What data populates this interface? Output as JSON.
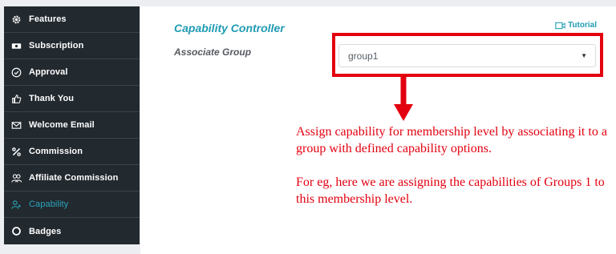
{
  "sidebar": {
    "items": [
      {
        "label": "Features",
        "icon": "gear-icon"
      },
      {
        "label": "Subscription",
        "icon": "money-icon"
      },
      {
        "label": "Approval",
        "icon": "check-circle-icon"
      },
      {
        "label": "Thank You",
        "icon": "thumbs-up-icon"
      },
      {
        "label": "Welcome Email",
        "icon": "mail-icon"
      },
      {
        "label": "Commission",
        "icon": "percent-icon"
      },
      {
        "label": "Affiliate Commission",
        "icon": "users-icon"
      },
      {
        "label": "Capability",
        "icon": "user-plus-icon",
        "active": true
      },
      {
        "label": "Badges",
        "icon": "circle-icon"
      }
    ]
  },
  "main": {
    "title": "Capability Controller",
    "tutorial_label": "Tutorial",
    "field_label": "Associate Group",
    "select_value": "group1"
  },
  "annotation": {
    "line1": "Assign capability for membership level by associating it to a group with defined capability options.",
    "line2": "For eg, here we are assigning the capabilities of Groups 1 to this membership level."
  },
  "colors": {
    "sidebar_bg": "#22292f",
    "accent": "#1f9bb3",
    "highlight": "#e3000f"
  }
}
